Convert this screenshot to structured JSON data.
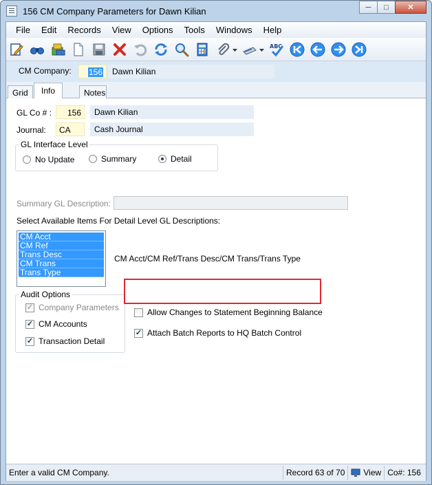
{
  "window": {
    "title": "156 CM Company Parameters for Dawn Kilian"
  },
  "menu": [
    "File",
    "Edit",
    "Records",
    "View",
    "Options",
    "Tools",
    "Windows",
    "Help"
  ],
  "header": {
    "cm_company_label": "CM Company:",
    "cm_company_value": "156",
    "cm_company_name": "Dawn Kilian"
  },
  "tabs": [
    "Grid",
    "Info",
    "Notes"
  ],
  "info": {
    "glco_label": "GL Co # :",
    "glco_value": "156",
    "glco_name": "Dawn Kilian",
    "journal_label": "Journal:",
    "journal_value": "CA",
    "journal_name": "Cash Journal",
    "gl_interface_title": "GL Interface Level",
    "gl_options": [
      "No Update",
      "Summary",
      "Detail"
    ],
    "gl_selected": "Detail",
    "summary_desc_label": "Summary GL Description:",
    "summary_desc_value": "",
    "select_items_label": "Select Available Items For Detail Level GL Descriptions:",
    "available_items": [
      "CM Acct",
      "CM Ref",
      "Trans Desc",
      "CM Trans",
      "Trans Type"
    ],
    "detail_desc_value": "CM Acct/CM Ref/Trans Desc/CM Trans/Trans Type",
    "audit_title": "Audit Options",
    "audit_options": [
      {
        "label": "Company Parameters",
        "checked": true,
        "disabled": true
      },
      {
        "label": "CM Accounts",
        "checked": true,
        "disabled": false
      },
      {
        "label": "Transaction Detail",
        "checked": true,
        "disabled": false
      }
    ],
    "allow_changes_label": "Allow Changes to Statement Beginning Balance",
    "allow_changes_checked": false,
    "attach_batch_label": "Attach Batch Reports to HQ Batch Control",
    "attach_batch_checked": true
  },
  "status": {
    "message": "Enter a valid CM Company.",
    "record": "Record 63 of 70",
    "mode": "View",
    "company": "Co#: 156"
  },
  "colors": {
    "highlight": "#e0282e",
    "selection": "#3399ff"
  }
}
